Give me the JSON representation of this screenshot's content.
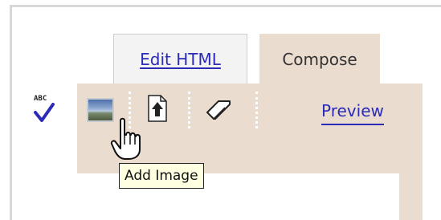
{
  "tabs": [
    {
      "label": "Edit HTML",
      "active": false
    },
    {
      "label": "Compose",
      "active": true
    }
  ],
  "toolbar": {
    "spell_icon_text": "ABC",
    "preview_label": "Preview",
    "tooltip": "Add Image"
  },
  "icons": {
    "spell": "spell-check-icon",
    "image": "add-image-icon",
    "upload": "upload-file-icon",
    "eraser": "eraser-icon",
    "cursor": "hand-cursor-icon"
  },
  "colors": {
    "toolbar_bg": "#ebdcd0",
    "link": "#2b2bb8",
    "tooltip_bg": "#ffffe1"
  }
}
